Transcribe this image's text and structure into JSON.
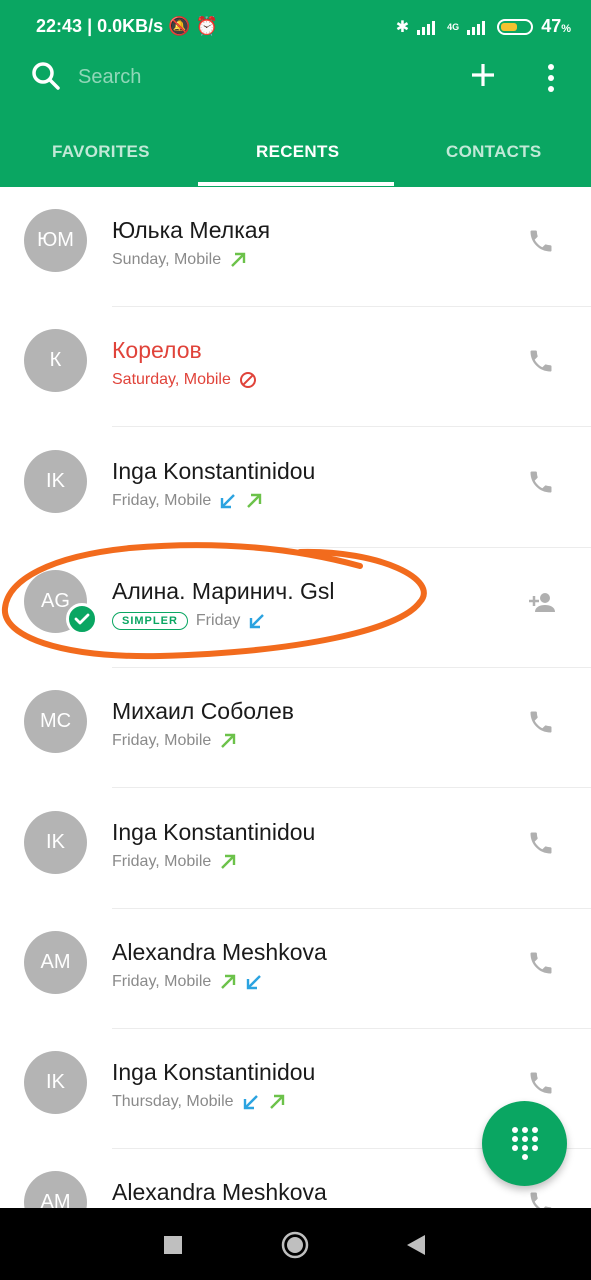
{
  "status_bar": {
    "time": "22:43",
    "network_speed": "| 0.0KB/s",
    "battery": "47",
    "battery_unit": "%",
    "network_type": "4G"
  },
  "search": {
    "placeholder": "Search"
  },
  "tabs": [
    {
      "label": "FAVORITES",
      "active": false
    },
    {
      "label": "RECENTS",
      "active": true
    },
    {
      "label": "CONTACTS",
      "active": false
    }
  ],
  "calls": [
    {
      "initials": "ЮМ",
      "name": "Юлька Мелкая",
      "detail": "Sunday, Mobile",
      "types": [
        "outgoing"
      ],
      "missed": false,
      "action": "call"
    },
    {
      "initials": "К",
      "name": "Корелов",
      "detail": "Saturday, Mobile",
      "types": [
        "blocked"
      ],
      "missed": true,
      "action": "call"
    },
    {
      "initials": "IK",
      "name": "Inga Konstantinidou",
      "detail": "Friday, Mobile",
      "types": [
        "incoming",
        "outgoing"
      ],
      "missed": false,
      "action": "call"
    },
    {
      "initials": "AG",
      "name": "Алина. Маринич. Gsl",
      "badge": "SIMPLER",
      "detail": "Friday",
      "types": [
        "incoming"
      ],
      "missed": false,
      "action": "add-contact",
      "verified": true
    },
    {
      "initials": "MC",
      "name": "Михаил Соболев",
      "detail": "Friday, Mobile",
      "types": [
        "outgoing"
      ],
      "missed": false,
      "action": "call"
    },
    {
      "initials": "IK",
      "name": "Inga Konstantinidou",
      "detail": "Friday, Mobile",
      "types": [
        "outgoing"
      ],
      "missed": false,
      "action": "call"
    },
    {
      "initials": "AM",
      "name": "Alexandra Meshkova",
      "detail": "Friday, Mobile",
      "types": [
        "outgoing",
        "incoming"
      ],
      "missed": false,
      "action": "call"
    },
    {
      "initials": "IK",
      "name": "Inga Konstantinidou",
      "detail": "Thursday, Mobile",
      "types": [
        "incoming",
        "outgoing"
      ],
      "missed": false,
      "action": "call"
    },
    {
      "initials": "AM",
      "name": "Alexandra Meshkova",
      "detail": "",
      "types": [],
      "missed": false,
      "action": "call"
    }
  ],
  "colors": {
    "brand": "#0aa662",
    "missed": "#e0433a",
    "outgoing": "#6cc24a",
    "incoming": "#2ba3e0",
    "annotation": "#f26b1d"
  }
}
